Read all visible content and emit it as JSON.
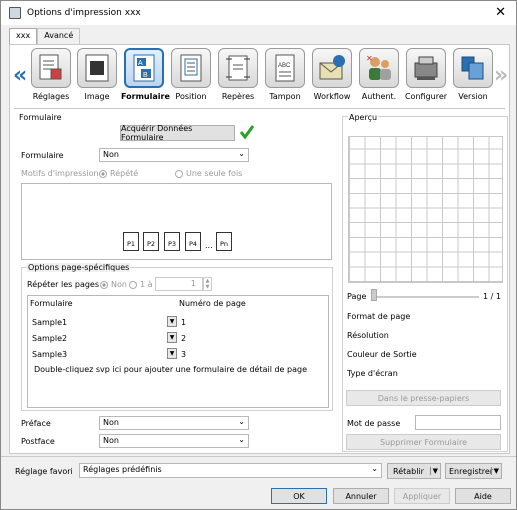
{
  "window": {
    "title": "Options d'impression xxx"
  },
  "tabs": [
    "xxx",
    "Avancé"
  ],
  "iconbar": [
    "Réglages",
    "Image",
    "Formulaire",
    "Position",
    "Repères",
    "Tampon",
    "Workflow",
    "Authent.",
    "Configurer",
    "Version"
  ],
  "formulaire": {
    "group_label": "Formulaire",
    "acquire_button": "Acquérir Données Formulaire",
    "form_label": "Formulaire",
    "form_value": "Non",
    "motif_label": "Motifs d'impression",
    "motif_opt1": "Répété",
    "motif_opt2": "Une seule fois",
    "pages": [
      "P1",
      "P2",
      "P3",
      "P4",
      "Pn"
    ],
    "ellipsis": "..."
  },
  "page_options": {
    "group_label": "Options page-spécifiques",
    "repeat_label": "Répéter les pages",
    "opt_non": "Non",
    "opt_range": "1 à",
    "range_value": "1",
    "col1": "Formulaire",
    "col2": "Numéro de page",
    "rows": [
      {
        "form": "Sample1",
        "num": "1"
      },
      {
        "form": "Sample2",
        "num": "2"
      },
      {
        "form": "Sample3",
        "num": "3"
      }
    ],
    "hint": "Double-cliquez svp ici pour ajouter une formulaire de détail de page"
  },
  "preface": {
    "label": "Préface",
    "value": "Non"
  },
  "postface": {
    "label": "Postface",
    "value": "Non"
  },
  "apercu": {
    "label": "Aperçu",
    "page_label": "Page",
    "page_count": "1 / 1",
    "format": "Format de page",
    "resolution": "Résolution",
    "couleur": "Couleur de Sortie",
    "ecran": "Type d'écran",
    "clipboard_button": "Dans le presse-papiers",
    "password_label": "Mot de passe",
    "password_value": "",
    "delete_button": "Supprimer Formulaire"
  },
  "footer": {
    "fav_label": "Réglage favori",
    "fav_value": "Réglages prédéfinis",
    "retablir": "Rétablir",
    "enregistrer": "Enregistrer",
    "ok": "OK",
    "annuler": "Annuler",
    "appliquer": "Appliquer",
    "aide": "Aide"
  },
  "colors": {
    "accent": "#2a6fb0",
    "checkmark": "#2aa02a"
  }
}
